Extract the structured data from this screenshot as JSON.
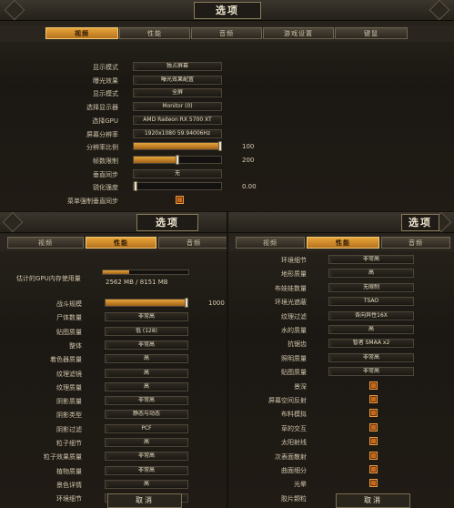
{
  "top": {
    "title": "选项",
    "tabs": [
      "视频",
      "性能",
      "音频",
      "游戏设置",
      "键鼠"
    ],
    "active_tab": 0,
    "rows": [
      {
        "label": "显示模式",
        "value": "独占屏幕",
        "kind": "drop"
      },
      {
        "label": "曝光效果",
        "value": "曝光效果配置",
        "kind": "drop"
      },
      {
        "label": "显示模式",
        "value": "全屏",
        "kind": "drop"
      },
      {
        "label": "选择显示器",
        "value": "Monitor (0)",
        "kind": "drop"
      },
      {
        "label": "选择GPU",
        "value": "AMD Radeon RX 5700 XT",
        "kind": "drop"
      },
      {
        "label": "屏幕分辨率",
        "value": "1920x1080 59.94006Hz",
        "kind": "drop"
      },
      {
        "label": "分辨率比例",
        "value": "100",
        "kind": "slider",
        "level": 1.0
      },
      {
        "label": "帧数限制",
        "value": "200",
        "kind": "slider",
        "level": 0.5
      },
      {
        "label": "垂直同步",
        "value": "无",
        "kind": "drop"
      },
      {
        "label": "锐化强度",
        "value": "0.00",
        "kind": "slider",
        "level": 0.0
      },
      {
        "label": "菜单强制垂直同步",
        "value": "",
        "kind": "check"
      }
    ]
  },
  "left": {
    "title": "选项",
    "tabs": [
      "视频",
      "性能",
      "音频"
    ],
    "active_tab": 1,
    "vram_label": "估计的GPU内存使用量",
    "vram_text": "2562 MB / 8151 MB",
    "vram_level": 0.31,
    "rows": [
      {
        "label": "战斗规模",
        "value": "1000",
        "kind": "slider",
        "level": 1.0
      },
      {
        "label": "尸体数量",
        "value": "非常高",
        "kind": "drop"
      },
      {
        "label": "贴图质量",
        "value": "低 (128)",
        "kind": "drop"
      },
      {
        "label": "整体",
        "value": "非常高",
        "kind": "drop"
      },
      {
        "label": "着色器质量",
        "value": "高",
        "kind": "drop"
      },
      {
        "label": "纹理滤镜",
        "value": "高",
        "kind": "drop"
      },
      {
        "label": "纹理质量",
        "value": "高",
        "kind": "drop"
      },
      {
        "label": "阴影质量",
        "value": "非常高",
        "kind": "drop"
      },
      {
        "label": "阴影类型",
        "value": "静态与动态",
        "kind": "drop"
      },
      {
        "label": "阴影过滤",
        "value": "PCF",
        "kind": "drop"
      },
      {
        "label": "粒子细节",
        "value": "高",
        "kind": "drop"
      },
      {
        "label": "粒子效果质量",
        "value": "非常高",
        "kind": "drop"
      },
      {
        "label": "植物质量",
        "value": "非常高",
        "kind": "drop"
      },
      {
        "label": "景色详情",
        "value": "高",
        "kind": "drop"
      },
      {
        "label": "环境细节",
        "value": "",
        "kind": "drop"
      }
    ],
    "bottom_button": "取消"
  },
  "right": {
    "title": "选项",
    "tabs": [
      "视频",
      "性能",
      "音频"
    ],
    "active_tab": 1,
    "rows": [
      {
        "label": "环境细节",
        "value": "非常高",
        "kind": "drop"
      },
      {
        "label": "地形质量",
        "value": "高",
        "kind": "drop"
      },
      {
        "label": "布娃娃数量",
        "value": "无限制",
        "kind": "drop"
      },
      {
        "label": "环境光遮蔽",
        "value": "TSAO",
        "kind": "drop"
      },
      {
        "label": "纹理过滤",
        "value": "各向异性16X",
        "kind": "drop"
      },
      {
        "label": "水的质量",
        "value": "高",
        "kind": "drop"
      },
      {
        "label": "抗锯齿",
        "value": "智者 SMAA x2",
        "kind": "drop"
      },
      {
        "label": "照明质量",
        "value": "非常高",
        "kind": "drop"
      },
      {
        "label": "贴图质量",
        "value": "非常高",
        "kind": "drop"
      },
      {
        "label": "景深",
        "value": "",
        "kind": "check"
      },
      {
        "label": "屏幕空间反射",
        "value": "",
        "kind": "check"
      },
      {
        "label": "布料模拟",
        "value": "",
        "kind": "check"
      },
      {
        "label": "草的交互",
        "value": "",
        "kind": "check"
      },
      {
        "label": "太阳射线",
        "value": "",
        "kind": "check"
      },
      {
        "label": "次表面散射",
        "value": "",
        "kind": "check"
      },
      {
        "label": "曲面细分",
        "value": "",
        "kind": "check"
      },
      {
        "label": "光晕",
        "value": "",
        "kind": "check"
      },
      {
        "label": "胶片颗粒",
        "value": "",
        "kind": "check"
      }
    ],
    "bottom_button": "取消"
  }
}
